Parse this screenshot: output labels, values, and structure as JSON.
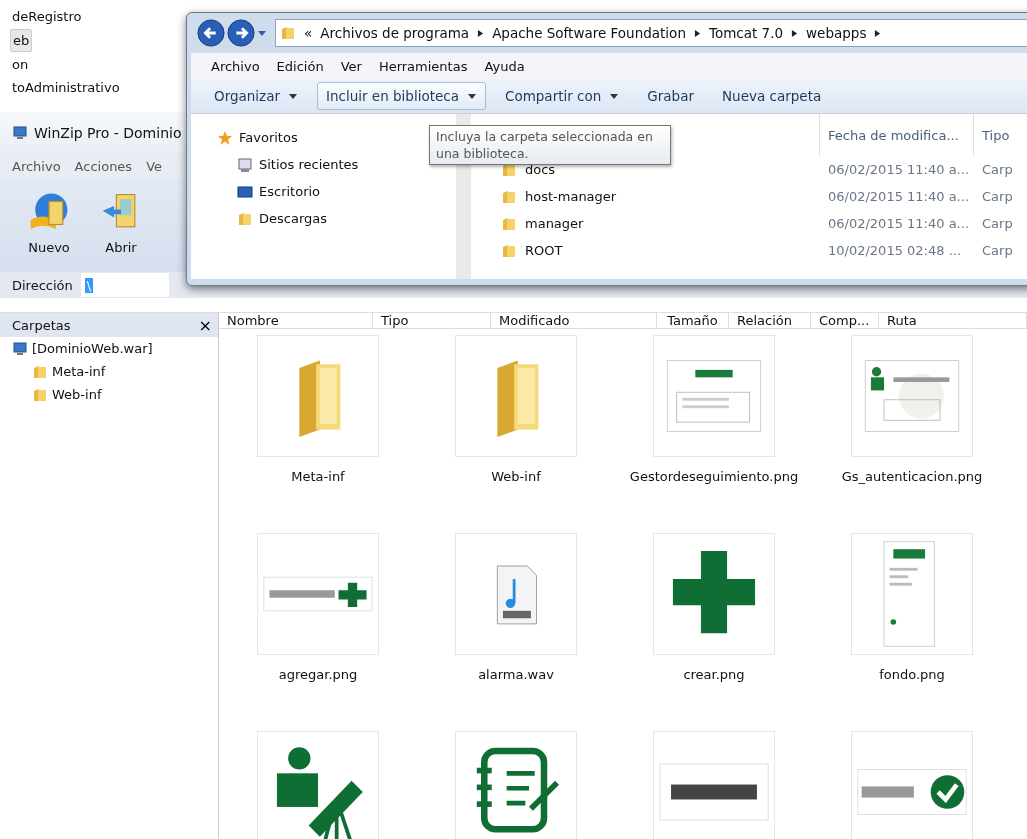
{
  "background_window": {
    "items": [
      {
        "label": "deRegistro",
        "selected": false
      },
      {
        "label": "eb",
        "selected": true
      },
      {
        "label": "on",
        "selected": false
      },
      {
        "label": "toAdministrativo",
        "selected": false
      }
    ]
  },
  "winzip": {
    "title": "WinZip Pro - Dominio",
    "menu": [
      "Archivo",
      "Acciones",
      "Ve"
    ],
    "toolbar": [
      {
        "label": "Nuevo",
        "kind": "new"
      },
      {
        "label": "Abrir",
        "kind": "open"
      }
    ],
    "address": {
      "label": "Dirección",
      "value": "\\"
    },
    "folders_pane": {
      "title": "Carpetas",
      "close": "×",
      "tree": [
        {
          "label": "[DominioWeb.war]",
          "kind": "archive",
          "children": [
            {
              "label": "Meta-inf",
              "kind": "folder"
            },
            {
              "label": "Web-inf",
              "kind": "folder"
            }
          ]
        }
      ]
    },
    "columns": [
      "Nombre",
      "Tipo",
      "Modificado",
      "Tamaño",
      "Relación",
      "Comp...",
      "Ruta"
    ],
    "files": [
      {
        "name": "Meta-inf",
        "kind": "folder"
      },
      {
        "name": "Web-inf",
        "kind": "folder"
      },
      {
        "name": "Gestordeseguimiento.png",
        "kind": "screen"
      },
      {
        "name": "Gs_autenticacion.png",
        "kind": "screen-logo"
      },
      {
        "name": "agregar.png",
        "kind": "banner-plus"
      },
      {
        "name": "alarma.wav",
        "kind": "audio"
      },
      {
        "name": "crear.png",
        "kind": "cross"
      },
      {
        "name": "fondo.png",
        "kind": "page"
      },
      {
        "kind": "telescope"
      },
      {
        "kind": "notepad"
      },
      {
        "kind": "banner"
      },
      {
        "kind": "banner-check"
      }
    ]
  },
  "explorer": {
    "breadcrumb": [
      "«",
      "Archivos de programa",
      "Apache Software Foundation",
      "Tomcat 7.0",
      "webapps"
    ],
    "menu": [
      "Archivo",
      "Edición",
      "Ver",
      "Herramientas",
      "Ayuda"
    ],
    "toolbar": [
      {
        "label": "Organizar",
        "dropdown": true,
        "selected": false
      },
      {
        "label": "Incluir en biblioteca",
        "dropdown": true,
        "selected": true
      },
      {
        "label": "Compartir con",
        "dropdown": true,
        "selected": false
      },
      {
        "label": "Grabar",
        "dropdown": false,
        "selected": false
      },
      {
        "label": "Nueva carpeta",
        "dropdown": false,
        "selected": false
      }
    ],
    "nav": [
      {
        "label": "Favoritos",
        "kind": "star"
      },
      {
        "label": "Sitios recientes",
        "kind": "recent"
      },
      {
        "label": "Escritorio",
        "kind": "desktop"
      },
      {
        "label": "Descargas",
        "kind": "folder"
      }
    ],
    "columns": [
      "Fecha de modifica...",
      "Tipo"
    ],
    "rows": [
      {
        "name": "docs",
        "date": "06/02/2015 11:40 a...",
        "type": "Carp"
      },
      {
        "name": "host-manager",
        "date": "06/02/2015 11:40 a...",
        "type": "Carp"
      },
      {
        "name": "manager",
        "date": "06/02/2015 11:40 a...",
        "type": "Carp"
      },
      {
        "name": "ROOT",
        "date": "10/02/2015 02:48 ...",
        "type": "Carp"
      }
    ],
    "tooltip": "Incluya la carpeta seleccionada en una biblioteca."
  }
}
